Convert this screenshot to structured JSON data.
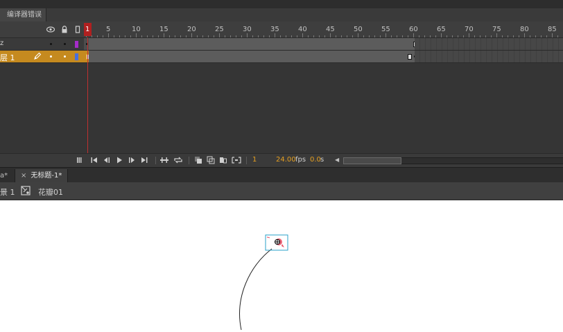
{
  "panel_tab": {
    "label": "编译器错误"
  },
  "timeline": {
    "ruler_labels": [
      "1",
      "5",
      "10",
      "15",
      "20",
      "25",
      "30",
      "35",
      "40",
      "45",
      "50",
      "55",
      "60",
      "65",
      "70",
      "75",
      "80",
      "85"
    ],
    "current_frame_marker": "1",
    "layers": [
      {
        "name": "z",
        "color": "#a52cc9"
      },
      {
        "name": "层 1",
        "color": "#4a6fdc"
      }
    ],
    "footer": {
      "current_frame": "1",
      "fps_value": "24.00",
      "fps_unit": "fps",
      "time_value": "0.0",
      "time_unit": "s"
    }
  },
  "doc_tabs": {
    "previous_tab": "a*",
    "active_tab": "无标题-1*",
    "close_glyph": "×"
  },
  "edit_bar": {
    "scene": "景 1",
    "symbol": "花瓣01"
  }
}
